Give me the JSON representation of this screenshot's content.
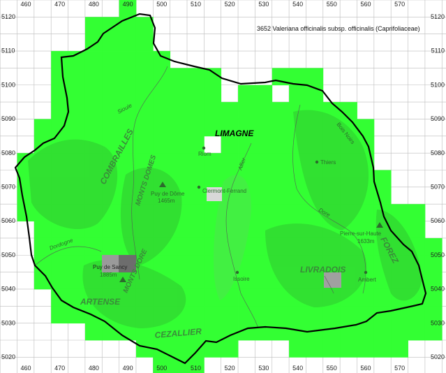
{
  "title": "3652 Valeriana officinalis subsp. officinalis (Caprifoliaceae)",
  "x_ticks": [
    "460",
    "470",
    "480",
    "490",
    "500",
    "510",
    "520",
    "530",
    "540",
    "550",
    "560",
    "570"
  ],
  "y_ticks": [
    "5120",
    "5110",
    "5100",
    "5090",
    "5080",
    "5070",
    "5060",
    "5050",
    "5040",
    "5030",
    "5020"
  ],
  "regions": {
    "limagne": "LIMAGNE",
    "combrailles": "COMBRAILLES",
    "monts_domes": "MONTS DOMES",
    "monts_dore": "MONTS DORE",
    "artense": "ARTENSE",
    "cezallier": "CEZALLIER",
    "livradois": "LIVRADOIS",
    "forez": "FOREZ",
    "bois_noirs": "Bois Noirs"
  },
  "places": {
    "riom": "Riom",
    "thiers": "Thiers",
    "clermont": "Clermont-Ferrand",
    "puy_dome": "Puy de Dôme",
    "puy_dome_alt": "1465m",
    "puy_sancy": "Puy de Sancy",
    "puy_sancy_alt": "1885m",
    "issoire": "Issoire",
    "ambert": "Ambert",
    "pierre_haute": "Pierre-sur-Haute",
    "pierre_haute_alt": "1633m"
  },
  "rivers": {
    "sioule": "Sioule",
    "allier": "Allier",
    "dore": "Dore",
    "dordogne": "Dordogne"
  },
  "colors": {
    "presence": "#33ff33",
    "relief": "#2fb32f",
    "border": "#000000",
    "grid": "#bbbbbb"
  }
}
